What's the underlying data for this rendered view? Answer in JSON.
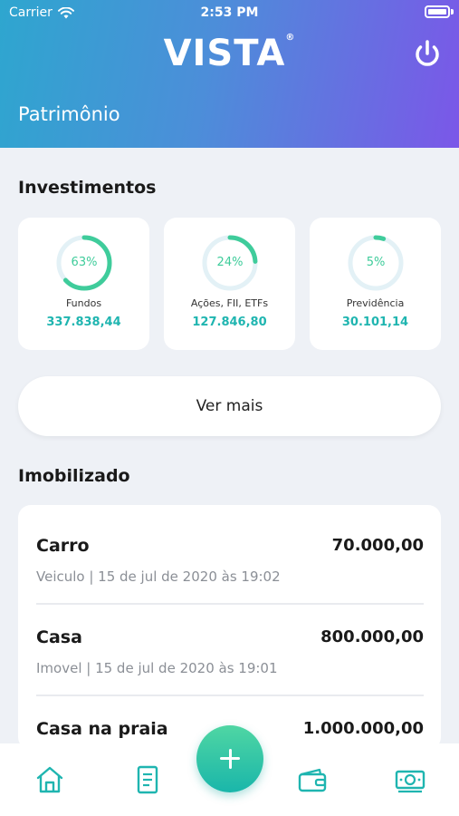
{
  "status_bar": {
    "carrier": "Carrier",
    "time": "2:53 PM"
  },
  "header": {
    "logo": "VISTA",
    "logo_mark": "®",
    "title": "Patrimônio",
    "power_icon": "power-icon"
  },
  "investimentos": {
    "title": "Investimentos",
    "cards": [
      {
        "percent_label": "63%",
        "percent": 63,
        "label": "Fundos",
        "value": "337.838,44"
      },
      {
        "percent_label": "24%",
        "percent": 24,
        "label": "Ações, FII, ETFs",
        "value": "127.846,80"
      },
      {
        "percent_label": "5%",
        "percent": 5,
        "label": "Previdência",
        "value": "30.101,14"
      }
    ],
    "ring_color": "#3fcc9b",
    "ring_track_color": "#e3f1f6"
  },
  "ver_mais_label": "Ver mais",
  "imobilizado": {
    "title": "Imobilizado",
    "items": [
      {
        "name": "Carro",
        "value": "70.000,00",
        "subtitle": "Veiculo | 15 de jul de 2020 às 19:02"
      },
      {
        "name": "Casa",
        "value": "800.000,00",
        "subtitle": "Imovel | 15 de jul de 2020 às 19:01"
      },
      {
        "name": "Casa na praia",
        "value": "1.000.000,00",
        "subtitle": ""
      }
    ]
  },
  "tab_bar": {
    "icons": [
      "home-icon",
      "document-icon",
      "add-icon",
      "wallet-icon",
      "money-icon"
    ],
    "accent": "#1fb5b0"
  }
}
